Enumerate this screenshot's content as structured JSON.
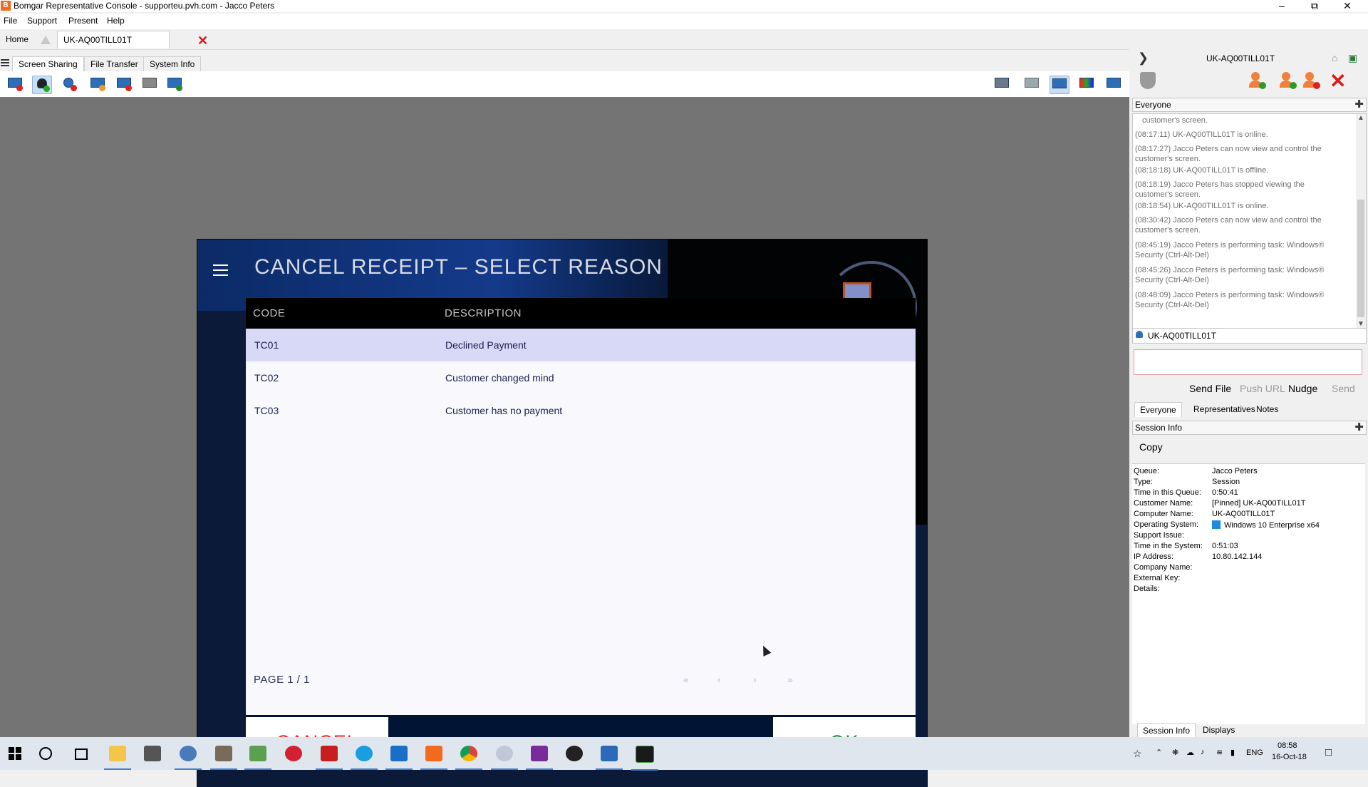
{
  "window": {
    "title": "Bomgar Representative Console - supporteu.pvh.com - Jacco Peters",
    "app_icon_letter": "B"
  },
  "menu": [
    "File",
    "Support",
    "Present",
    "Help"
  ],
  "session_tabs": {
    "home": "Home",
    "session": "UK-AQ00TILL01T"
  },
  "feature_tabs": [
    "Screen Sharing",
    "File Transfer",
    "System Info"
  ],
  "pos_dialog": {
    "title": "CANCEL RECEIPT – SELECT REASON",
    "columns": {
      "code": "CODE",
      "description": "DESCRIPTION"
    },
    "rows": [
      {
        "code": "TC01",
        "description": "Declined Payment",
        "selected": true
      },
      {
        "code": "TC02",
        "description": "Customer changed mind",
        "selected": false
      },
      {
        "code": "TC03",
        "description": "Customer has no payment",
        "selected": false
      }
    ],
    "pager": "PAGE 1 / 1",
    "nav": [
      "«",
      "‹",
      "›",
      "»"
    ],
    "cancel": "CANCEL",
    "ok": "OK"
  },
  "right_panel": {
    "session_name": "UK-AQ00TILL01T",
    "chat_header": "Everyone",
    "chat_log": [
      "customer's screen.",
      "(08:17:11) UK-AQ00TILL01T is online.",
      "(08:17:27) Jacco Peters can now view and control the customer's screen.",
      "(08:18:18) UK-AQ00TILL01T is offline.",
      "(08:18:19) Jacco Peters has stopped viewing the customer's screen.",
      "(08:18:54) UK-AQ00TILL01T is online.",
      "(08:30:42) Jacco Peters can now view and control the customer's screen.",
      "(08:45:19) Jacco Peters is performing task: Windows® Security (Ctrl-Alt-Del)",
      "(08:45:26) Jacco Peters is performing task: Windows® Security (Ctrl-Alt-Del)",
      "(08:48:09) Jacco Peters is performing task: Windows® Security (Ctrl-Alt-Del)"
    ],
    "chat_user": "UK-AQ00TILL01T",
    "chat_buttons": [
      "Send File",
      "Push URL",
      "Nudge",
      "Send"
    ],
    "chat_tabs": [
      "Everyone",
      "Representatives",
      "Notes"
    ],
    "session_info_header": "Session Info",
    "copy_label": "Copy",
    "session_info": [
      {
        "key": "Queue:",
        "value": "Jacco Peters"
      },
      {
        "key": "Type:",
        "value": "Session"
      },
      {
        "key": "Time in this Queue:",
        "value": "0:50:41"
      },
      {
        "key": "Customer Name:",
        "value": "[Pinned] UK-AQ00TILL01T"
      },
      {
        "key": "Computer Name:",
        "value": "UK-AQ00TILL01T"
      },
      {
        "key": "Operating System:",
        "value": "Windows 10 Enterprise x64"
      },
      {
        "key": "Support Issue:",
        "value": ""
      },
      {
        "key": "Time in the System:",
        "value": "0:51:03"
      },
      {
        "key": "IP Address:",
        "value": "10.80.142.144"
      },
      {
        "key": "Company Name:",
        "value": ""
      },
      {
        "key": "External Key:",
        "value": ""
      },
      {
        "key": "Details:",
        "value": ""
      }
    ],
    "bottom_tabs": [
      "Session Info",
      "Displays"
    ]
  },
  "taskbar": {
    "language": "ENG",
    "time": "08:58",
    "date": "16-Oct-18"
  },
  "colors": {
    "accent_orange": "#f26b1d",
    "cancel_red": "#e03030",
    "ok_green": "#1b8a4a",
    "selected_row": "#d8d8f7",
    "dialog_navy": "#0c1a3a"
  }
}
